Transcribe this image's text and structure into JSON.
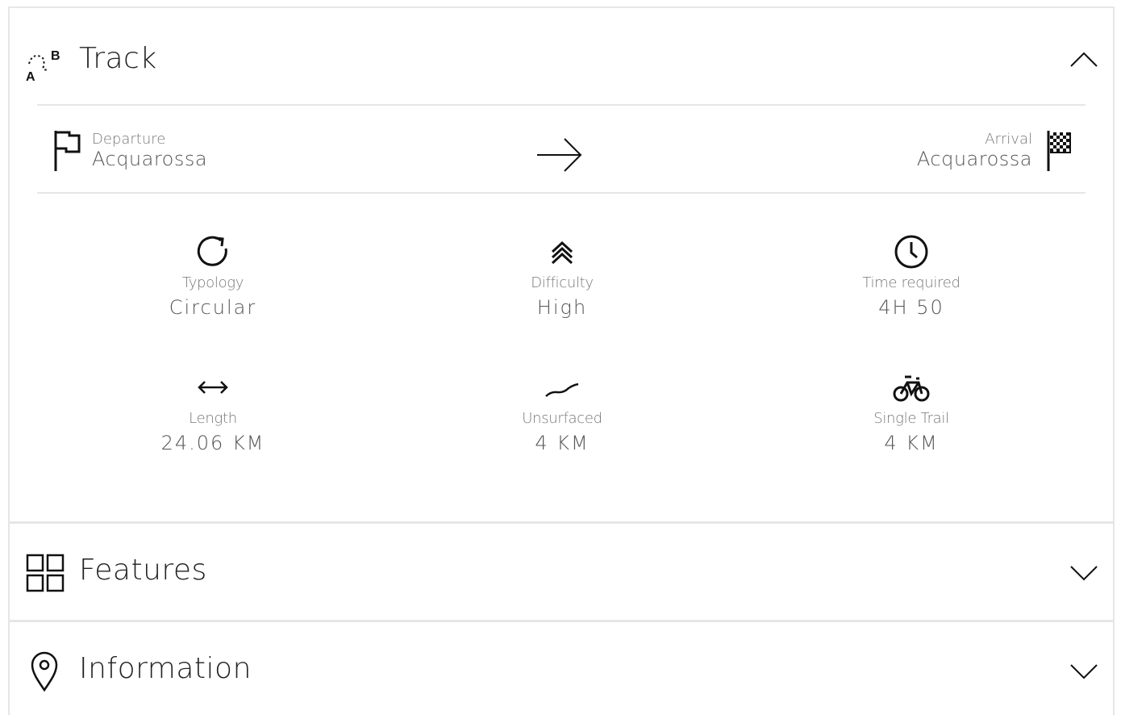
{
  "track": {
    "title": "Track",
    "icon": "route-a-b-icon",
    "expanded": true,
    "departure": {
      "label": "Departure",
      "value": "Acquarossa"
    },
    "arrival": {
      "label": "Arrival",
      "value": "Acquarossa"
    },
    "stats": [
      {
        "icon": "refresh-icon",
        "label": "Typology",
        "value": "Circular"
      },
      {
        "icon": "double-chevron-up-icon",
        "label": "Difficulty",
        "value": "High"
      },
      {
        "icon": "clock-icon",
        "label": "Time required",
        "value": "4H 50"
      },
      {
        "icon": "horizontal-arrows-icon",
        "label": "Length",
        "value": "24.06 KM"
      },
      {
        "icon": "unsurfaced-road-icon",
        "label": "Unsurfaced",
        "value": "4 KM"
      },
      {
        "icon": "bicycle-icon",
        "label": "Single Trail",
        "value": "4 KM"
      }
    ]
  },
  "features": {
    "title": "Features",
    "icon": "grid-icon",
    "expanded": false
  },
  "information": {
    "title": "Information",
    "icon": "map-pin-icon",
    "expanded": false
  },
  "colors": {
    "text": "#111111",
    "muted": "#777777",
    "value": "#555555",
    "divider": "#e6e6e6"
  }
}
